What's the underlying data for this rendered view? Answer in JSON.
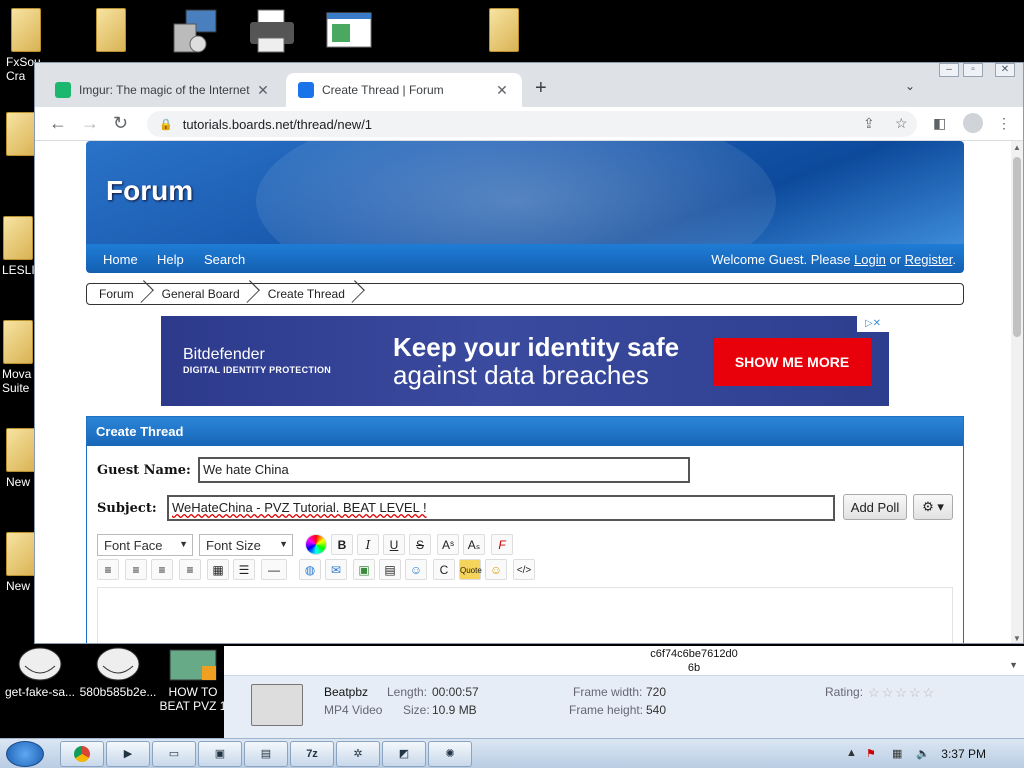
{
  "desktop": {
    "icons": [
      {
        "label": "FxSou\nCra"
      },
      {
        "label": ""
      },
      {
        "label": ""
      },
      {
        "label": ""
      },
      {
        "label": ""
      },
      {
        "label": ""
      },
      {
        "label": "LESLI"
      },
      {
        "label": "Mova\nSuite"
      },
      {
        "label": "New"
      },
      {
        "label": "New"
      }
    ],
    "files": [
      {
        "label": "get-fake-sa..."
      },
      {
        "label": "580b585b2e..."
      },
      {
        "label": "HOW TO\nBEAT PVZ 1"
      }
    ]
  },
  "browser": {
    "tabs": [
      {
        "title": "Imgur: The magic of the Internet",
        "close": "✕"
      },
      {
        "title": "Create Thread | Forum",
        "close": "✕"
      }
    ],
    "new_tab": "+",
    "tab_search": "⌄",
    "url": "tutorials.boards.net/thread/new/1"
  },
  "forum": {
    "logo": "Forum",
    "nav": {
      "home": "Home",
      "help": "Help",
      "search": "Search"
    },
    "welcome": {
      "prefix": "Welcome Guest. Please ",
      "login": "Login",
      "or": " or ",
      "register": "Register",
      "suffix": "."
    },
    "breadcrumbs": [
      "Forum",
      "General Board",
      "Create Thread"
    ],
    "ad": {
      "brand": "Bitdefender",
      "brand_sub": "DIGITAL IDENTITY PROTECTION",
      "headline1": "Keep your identity safe",
      "headline2": "against data breaches",
      "cta": "SHOW ME MORE"
    },
    "panel": {
      "title": "Create Thread",
      "guest_label": "Guest Name:",
      "guest_value": "We hate China",
      "subject_label": "Subject:",
      "subject_value": "WeHateChina - PVZ Tutorial. BEAT LEVEL !",
      "add_poll": "Add Poll",
      "font_face": "Font Face",
      "font_size": "Font Size"
    }
  },
  "preview": {
    "hash_line1": "c6f74c6be7612d0",
    "hash_line2": "6b",
    "name": "Beatpbz",
    "type": "MP4 Video",
    "length_label": "Length:",
    "length_value": "00:00:57",
    "size_label": "Size:",
    "size_value": "10.9 MB",
    "fw_label": "Frame width:",
    "fw_value": "720",
    "fh_label": "Frame height:",
    "fh_value": "540",
    "rating_label": "Rating:"
  },
  "taskbar": {
    "clock": "3:37 PM"
  }
}
